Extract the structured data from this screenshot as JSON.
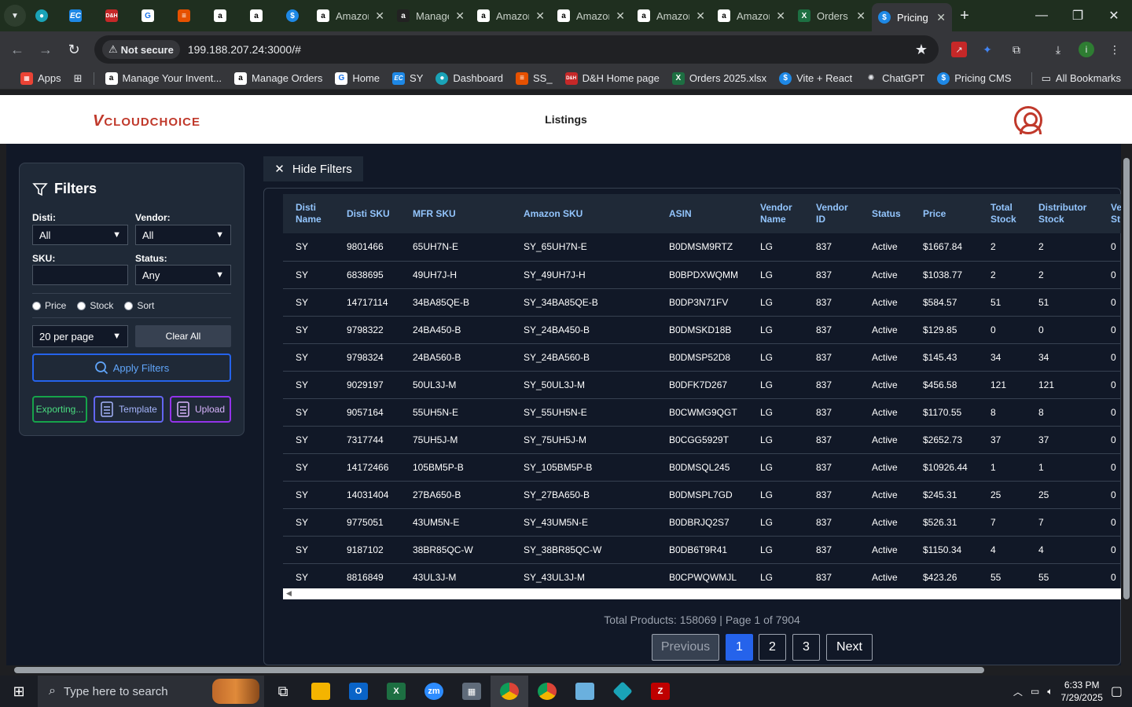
{
  "browser": {
    "pinned_tabs": [
      "edge-icon",
      "ec-icon",
      "dh-icon",
      "g-icon",
      "layers-icon",
      "amazon-icon",
      "amazon-icon",
      "dollar-icon"
    ],
    "tabs": [
      {
        "title": "Amazon",
        "icon": "amazon"
      },
      {
        "title": "Manage",
        "icon": "amazon"
      },
      {
        "title": "Amazon",
        "icon": "amazon"
      },
      {
        "title": "Amazon",
        "icon": "amazon"
      },
      {
        "title": "Amazon",
        "icon": "amazon"
      },
      {
        "title": "Amazon",
        "icon": "amazon"
      },
      {
        "title": "Orders",
        "icon": "excel"
      },
      {
        "title": "Pricing",
        "icon": "dollar",
        "active": true
      }
    ],
    "security_label": "Not secure",
    "url": "199.188.207.24:3000/#",
    "profile_initial": "i",
    "bookmarks": [
      "Apps",
      "Manage Your Invent...",
      "Manage Orders",
      "Home",
      "SY",
      "Dashboard",
      "SS_",
      "D&H Home page",
      "Orders 2025.xlsx",
      "Vite + React",
      "ChatGPT",
      "Pricing CMS"
    ],
    "all_bookmarks": "All Bookmarks"
  },
  "header": {
    "logo_v": "V",
    "logo_text": "CLOUDCHOICE",
    "title": "Listings"
  },
  "filters": {
    "title": "Filters",
    "disti_label": "Disti:",
    "disti_value": "All",
    "vendor_label": "Vendor:",
    "vendor_value": "All",
    "sku_label": "SKU:",
    "status_label": "Status:",
    "status_value": "Any",
    "radios": [
      "Price",
      "Stock",
      "Sort"
    ],
    "per_page": "20 per page",
    "clear_all": "Clear All",
    "apply": "Apply Filters",
    "exporting": "Exporting...",
    "template": "Template",
    "upload": "Upload",
    "hide_filters": "Hide Filters"
  },
  "table": {
    "columns": [
      "Disti Name",
      "Disti SKU",
      "MFR SKU",
      "Amazon SKU",
      "ASIN",
      "Vendor Name",
      "Vendor ID",
      "Status",
      "Price",
      "Total Stock",
      "Distributor Stock",
      "Ve St"
    ],
    "rows": [
      [
        "SY",
        "9801466",
        "65UH7N-E",
        "SY_65UH7N-E",
        "B0DMSM9RTZ",
        "LG",
        "837",
        "Active",
        "$1667.84",
        "2",
        "2",
        "0"
      ],
      [
        "SY",
        "6838695",
        "49UH7J-H",
        "SY_49UH7J-H",
        "B0BPDXWQMM",
        "LG",
        "837",
        "Active",
        "$1038.77",
        "2",
        "2",
        "0"
      ],
      [
        "SY",
        "14717114",
        "34BA85QE-B",
        "SY_34BA85QE-B",
        "B0DP3N71FV",
        "LG",
        "837",
        "Active",
        "$584.57",
        "51",
        "51",
        "0"
      ],
      [
        "SY",
        "9798322",
        "24BA450-B",
        "SY_24BA450-B",
        "B0DMSKD18B",
        "LG",
        "837",
        "Active",
        "$129.85",
        "0",
        "0",
        "0"
      ],
      [
        "SY",
        "9798324",
        "24BA560-B",
        "SY_24BA560-B",
        "B0DMSP52D8",
        "LG",
        "837",
        "Active",
        "$145.43",
        "34",
        "34",
        "0"
      ],
      [
        "SY",
        "9029197",
        "50UL3J-M",
        "SY_50UL3J-M",
        "B0DFK7D267",
        "LG",
        "837",
        "Active",
        "$456.58",
        "121",
        "121",
        "0"
      ],
      [
        "SY",
        "9057164",
        "55UH5N-E",
        "SY_55UH5N-E",
        "B0CWMG9QGT",
        "LG",
        "837",
        "Active",
        "$1170.55",
        "8",
        "8",
        "0"
      ],
      [
        "SY",
        "7317744",
        "75UH5J-M",
        "SY_75UH5J-M",
        "B0CGG5929T",
        "LG",
        "837",
        "Active",
        "$2652.73",
        "37",
        "37",
        "0"
      ],
      [
        "SY",
        "14172466",
        "105BM5P-B",
        "SY_105BM5P-B",
        "B0DMSQL245",
        "LG",
        "837",
        "Active",
        "$10926.44",
        "1",
        "1",
        "0"
      ],
      [
        "SY",
        "14031404",
        "27BA650-B",
        "SY_27BA650-B",
        "B0DMSPL7GD",
        "LG",
        "837",
        "Active",
        "$245.31",
        "25",
        "25",
        "0"
      ],
      [
        "SY",
        "9775051",
        "43UM5N-E",
        "SY_43UM5N-E",
        "B0DBRJQ2S7",
        "LG",
        "837",
        "Active",
        "$526.31",
        "7",
        "7",
        "0"
      ],
      [
        "SY",
        "9187102",
        "38BR85QC-W",
        "SY_38BR85QC-W",
        "B0DB6T9R41",
        "LG",
        "837",
        "Active",
        "$1150.34",
        "4",
        "4",
        "0"
      ],
      [
        "SY",
        "8816849",
        "43UL3J-M",
        "SY_43UL3J-M",
        "B0CPWQWMJL",
        "LG",
        "837",
        "Active",
        "$423.26",
        "55",
        "55",
        "0"
      ]
    ]
  },
  "pagination": {
    "summary": "Total Products: 158069 | Page 1 of 7904",
    "previous": "Previous",
    "pages": [
      "1",
      "2",
      "3"
    ],
    "current": "1",
    "next": "Next"
  },
  "taskbar": {
    "search_placeholder": "Type here to search",
    "time": "6:33 PM",
    "date": "7/29/2025"
  },
  "colors": {
    "accent_red": "#c0392b",
    "table_header_text": "#93c5fd",
    "page_bg": "#111827",
    "apply_border": "#2563eb",
    "export_border": "#16a34a",
    "template_border": "#6366f1",
    "upload_border": "#9333ea"
  }
}
